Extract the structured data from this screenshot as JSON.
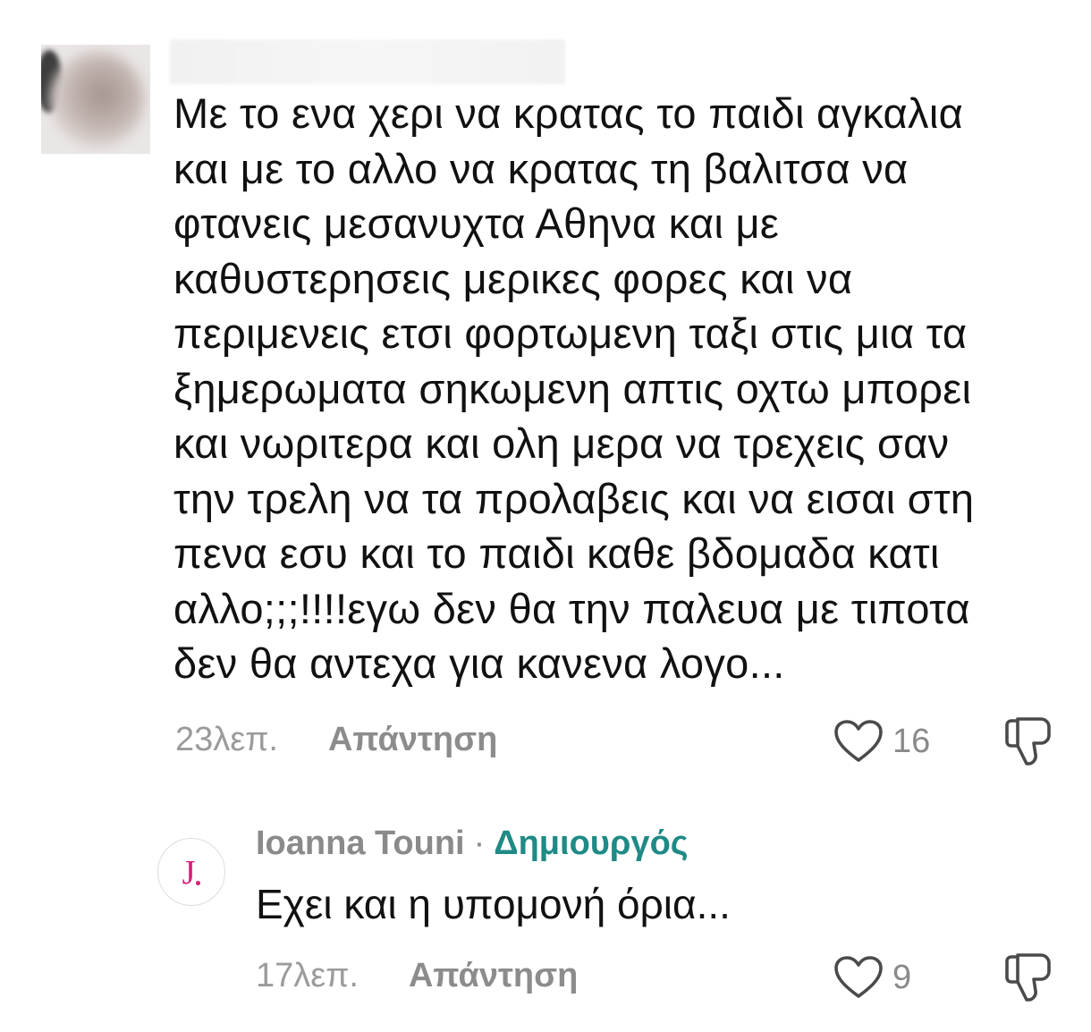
{
  "comments": [
    {
      "text": "Με το ενα χερι να κρατας το παιδι αγκαλια\nκαι με το αλλο να κρατας τη βαλιτσα να\nφτανεις μεσανυχτα Αθηνα και με\nκαθυστερησεις μερικες φορες και να\nπεριμενεις ετσι φορτωμενη ταξι στις μια τα\nξημερωματα σηκωμενη απτις οχτω μπορει\nκαι νωριτερα και ολη μερα να τρεχεις σαν\nτην τρελη να τα προλαβεις και να εισαι στη\nπενα εσυ και το παιδι καθε βδομαδα κατι\nαλλο;;;!!!!εγω δεν θα την παλευα με τιποτα\nδεν θα αντεχα για κανενα λογο...",
      "time": "23λεπ.",
      "reply_label": "Απάντηση",
      "likes": "16",
      "like_icon": "heart-outline",
      "dislike_icon": "thumbs-down-outline"
    }
  ],
  "reply": {
    "avatar_letter": "J",
    "author": "Ioanna Touni",
    "separator": "·",
    "creator_label": "Δημιουργός",
    "text": "Εχει και η υπομονή όρια...",
    "time": "17λεπ.",
    "reply_label": "Απάντηση",
    "likes": "9",
    "like_icon": "heart-outline",
    "dislike_icon": "thumbs-down-outline"
  },
  "colors": {
    "creator_accent": "#1f8a86",
    "avatar_letter": "#d81b7a",
    "muted": "#8a8a8a",
    "text": "#111111"
  }
}
